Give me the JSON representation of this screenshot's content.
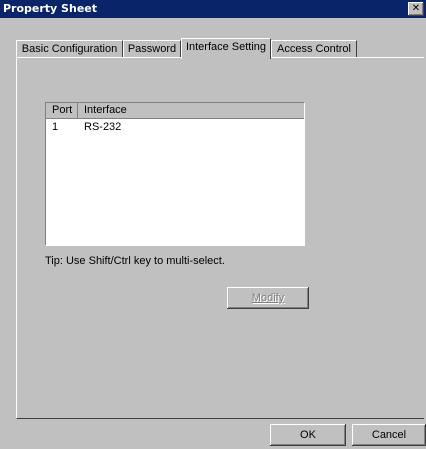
{
  "window": {
    "title": "Property Sheet",
    "close_glyph": "✕"
  },
  "tabs": [
    {
      "label": "Basic Configuration"
    },
    {
      "label": "Password"
    },
    {
      "label": "Interface Setting"
    },
    {
      "label": "Access Control"
    }
  ],
  "active_tab": "Interface Setting",
  "listview": {
    "columns": [
      "Port",
      "Interface"
    ],
    "rows": [
      {
        "port": "1",
        "interface": "RS-232"
      }
    ]
  },
  "tip": "Tip: Use Shift/Ctrl key to multi-select.",
  "buttons": {
    "modify": "Modify",
    "ok": "OK",
    "cancel": "Cancel"
  },
  "colors": {
    "titlebar": "#0a246a",
    "face": "#c0c0c0"
  }
}
